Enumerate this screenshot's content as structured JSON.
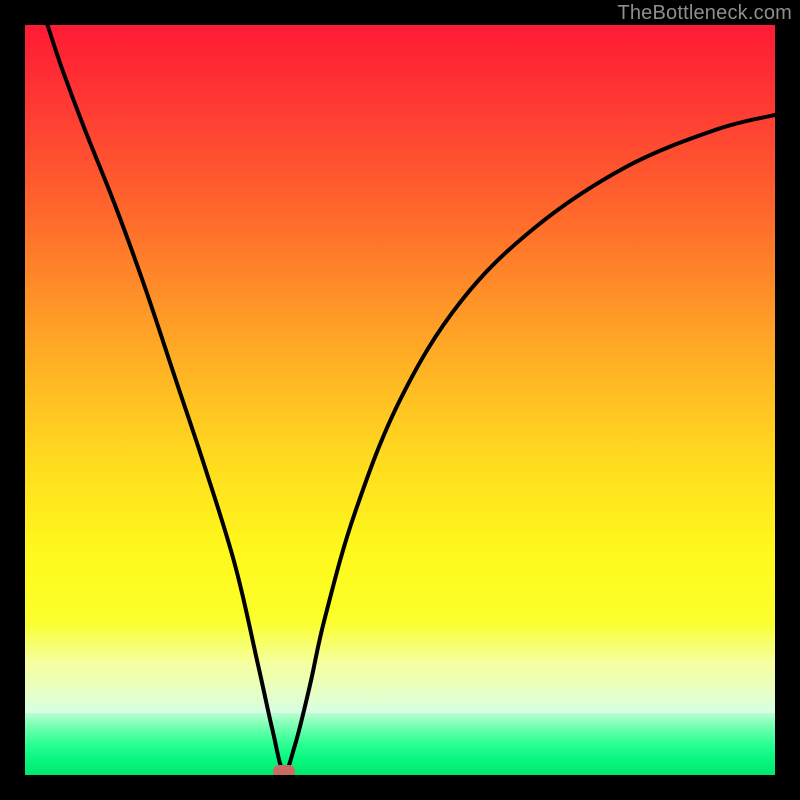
{
  "watermark": {
    "text": "TheBottleneck.com"
  },
  "chart_data": {
    "type": "line",
    "title": "",
    "xlabel": "",
    "ylabel": "",
    "xlim": [
      0,
      100
    ],
    "ylim": [
      0,
      100
    ],
    "grid": false,
    "legend": false,
    "series": [
      {
        "name": "bottleneck-curve",
        "x": [
          3,
          5,
          8,
          12,
          16,
          20,
          24,
          28,
          31,
          33,
          34.5,
          36,
          38,
          40,
          44,
          50,
          58,
          68,
          80,
          92,
          100
        ],
        "values": [
          100,
          94,
          86,
          76,
          65,
          53,
          41,
          28,
          15,
          6,
          0.5,
          4,
          12,
          21,
          35,
          50,
          63,
          73,
          81,
          86,
          88
        ]
      }
    ],
    "marker": {
      "x": 34.5,
      "y": 0.5,
      "color": "#c96b63"
    },
    "background_gradient": {
      "top_color": "#ff1a35",
      "mid_color": "#fff81c",
      "bottom_color": "#00e86d"
    }
  }
}
